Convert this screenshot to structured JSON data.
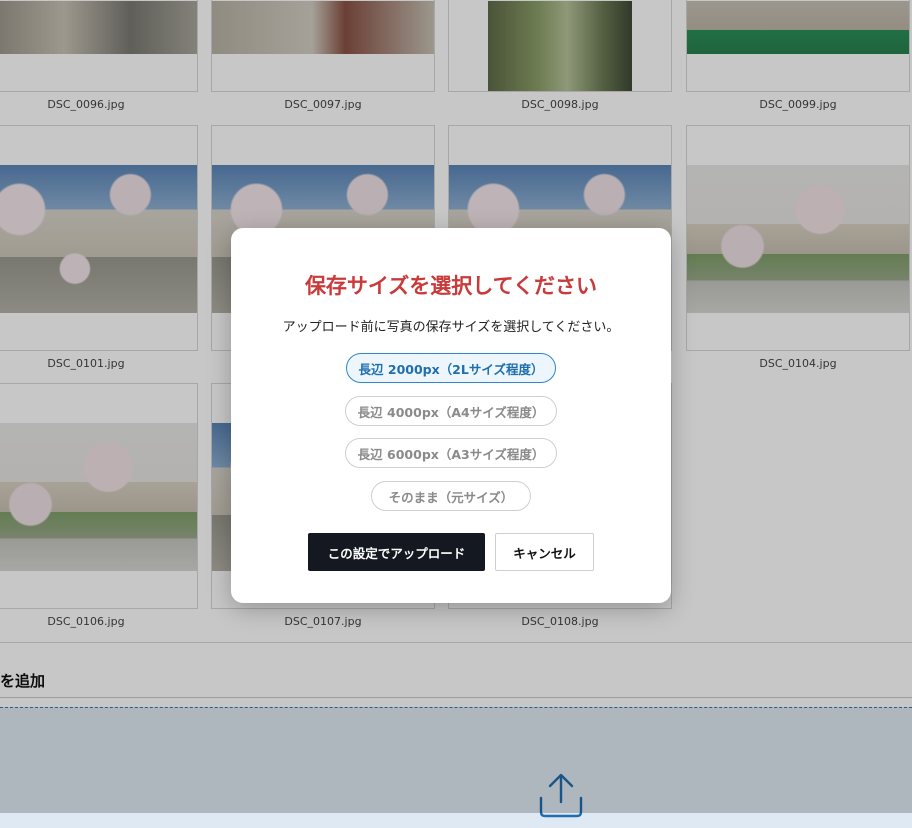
{
  "grid": {
    "rows": [
      [
        "DSC_0096.jpg",
        "DSC_0097.jpg",
        "DSC_0098.jpg",
        "DSC_0099.jpg"
      ],
      [
        "DSC_0101.jpg",
        "",
        "",
        "DSC_0104.jpg"
      ],
      [
        "DSC_0106.jpg",
        "DSC_0107.jpg",
        "DSC_0108.jpg"
      ]
    ]
  },
  "add_section": {
    "label": "を追加"
  },
  "modal": {
    "title": "保存サイズを選択してください",
    "description": "アップロード前に写真の保存サイズを選択してください。",
    "options": [
      {
        "label": "長辺 2000px（2Lサイズ程度）",
        "selected": true
      },
      {
        "label": "長辺 4000px（A4サイズ程度）",
        "selected": false
      },
      {
        "label": "長辺 6000px（A3サイズ程度）",
        "selected": false
      },
      {
        "label": "そのまま（元サイズ）",
        "selected": false
      }
    ],
    "confirm_label": "この設定でアップロード",
    "cancel_label": "キャンセル"
  },
  "colors": {
    "title": "#c93a3a",
    "selected_option": "#2f86c9",
    "primary_button": "#141820",
    "dropzone_border": "#2f78b8"
  },
  "icons": {
    "upload": "upload-arrow-icon"
  }
}
